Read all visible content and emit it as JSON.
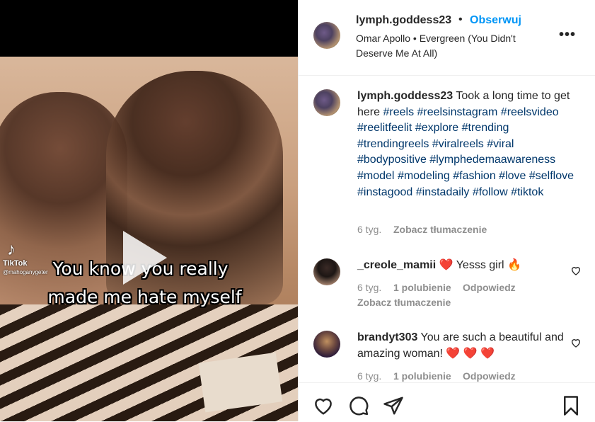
{
  "video": {
    "caption_line1": "You know you really",
    "caption_line2": "made me hate myself",
    "watermark_brand": "TikTok",
    "watermark_handle": "@mahoganygeter"
  },
  "post": {
    "username": "lymph.goddess23",
    "follow_label": "Obserwuj",
    "separator": "•",
    "audio": "Omar Apollo • Evergreen (You Didn't Deserve Me At All)"
  },
  "caption": {
    "username": "lymph.goddess23",
    "text": "Took a long time to get here",
    "hashtags": [
      "#reels",
      "#reelsinstagram",
      "#reelsvideo",
      "#reelitfeelit",
      "#explore",
      "#trending",
      "#trendingreels",
      "#viralreels",
      "#viral",
      "#bodypositive",
      "#lymphedemaawareness",
      "#model",
      "#modeling",
      "#fashion",
      "#love",
      "#selflove",
      "#instagood",
      "#instadaily",
      "#follow",
      "#tiktok"
    ],
    "age": "6 tyg.",
    "translate": "Zobacz tłumaczenie"
  },
  "comments": [
    {
      "username": "_creole_mamii",
      "text_before": "❤️",
      "text": "Yesss girl",
      "emoji_after": "🔥",
      "age": "6 tyg.",
      "likes": "1 polubienie",
      "reply": "Odpowiedz",
      "translate": "Zobacz tłumaczenie"
    },
    {
      "username": "brandyt303",
      "text": "You are such a beautiful and amazing woman!",
      "emoji_after": "❤️ ❤️ ❤️",
      "age": "6 tyg.",
      "likes": "1 polubienie",
      "reply": "Odpowiedz"
    }
  ],
  "icons": [
    "heart-icon",
    "comment-icon",
    "share-icon",
    "bookmark-icon",
    "more-icon"
  ],
  "colors": {
    "link": "#0095f6",
    "hashtag": "#00376b",
    "muted": "#8e8e8e",
    "heart": "#ed4956"
  }
}
